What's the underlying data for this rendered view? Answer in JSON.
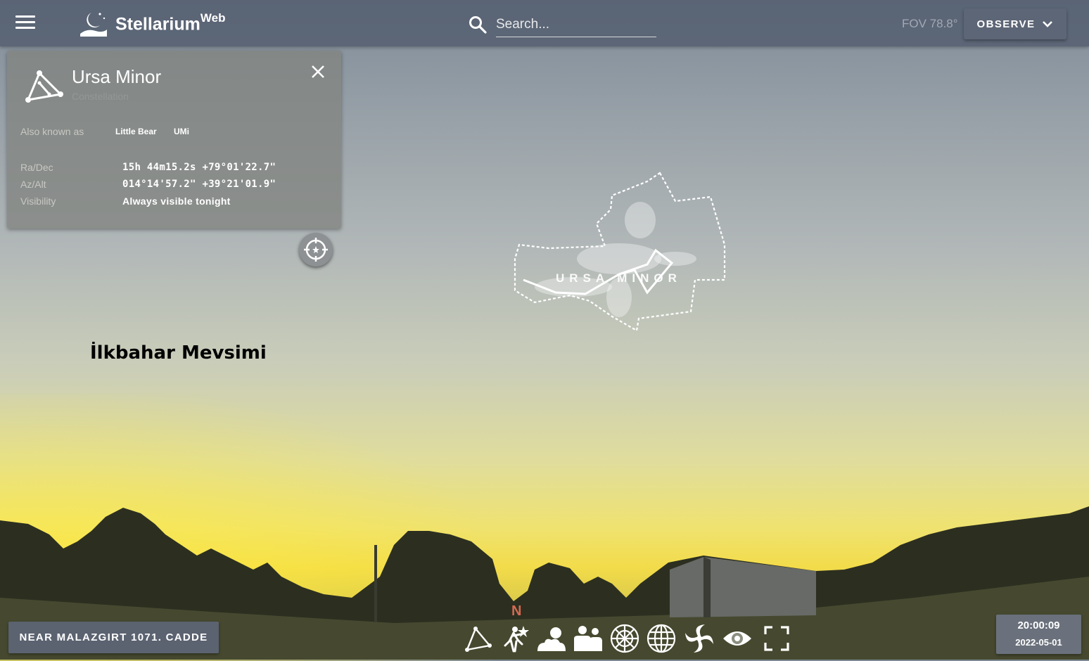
{
  "header": {
    "app_title": "Stellarium",
    "app_title_sup": "Web",
    "search_placeholder": "Search...",
    "fov": "FOV 78.8°",
    "observe_label": "OBSERVE"
  },
  "info_panel": {
    "title": "Ursa Minor",
    "subtitle": "Constellation",
    "also_known_label": "Also known as",
    "aliases": [
      "Little Bear",
      "UMi"
    ],
    "radec_label": "Ra/Dec",
    "radec_value": "15h 44m15.2s  +79°01'22.7\"",
    "azalt_label": "Az/Alt",
    "azalt_value": "014°14'57.2\"  +39°21'01.9\"",
    "visibility_label": "Visibility",
    "visibility_value": "Always visible tonight"
  },
  "overlay_text": "İlkbahar Mevsimi",
  "sky": {
    "constellation_label": "URSA MINOR",
    "north_marker": "N"
  },
  "footer": {
    "location": "NEAR MALAZGIRT 1071. CADDE",
    "time": "20:00:09",
    "date": "2022-05-01",
    "toolbar_icons": [
      "constellations-icon",
      "atmosphere-icon",
      "landscape-icon",
      "azimuthal-grid-icon",
      "equatorial-grid-icon",
      "deep-sky-objects-icon",
      "night-mode-icon",
      "fullscreen-icon"
    ]
  },
  "colors": {
    "topbar": "#505a6c",
    "panel": "#828480",
    "button": "#5b6270"
  }
}
